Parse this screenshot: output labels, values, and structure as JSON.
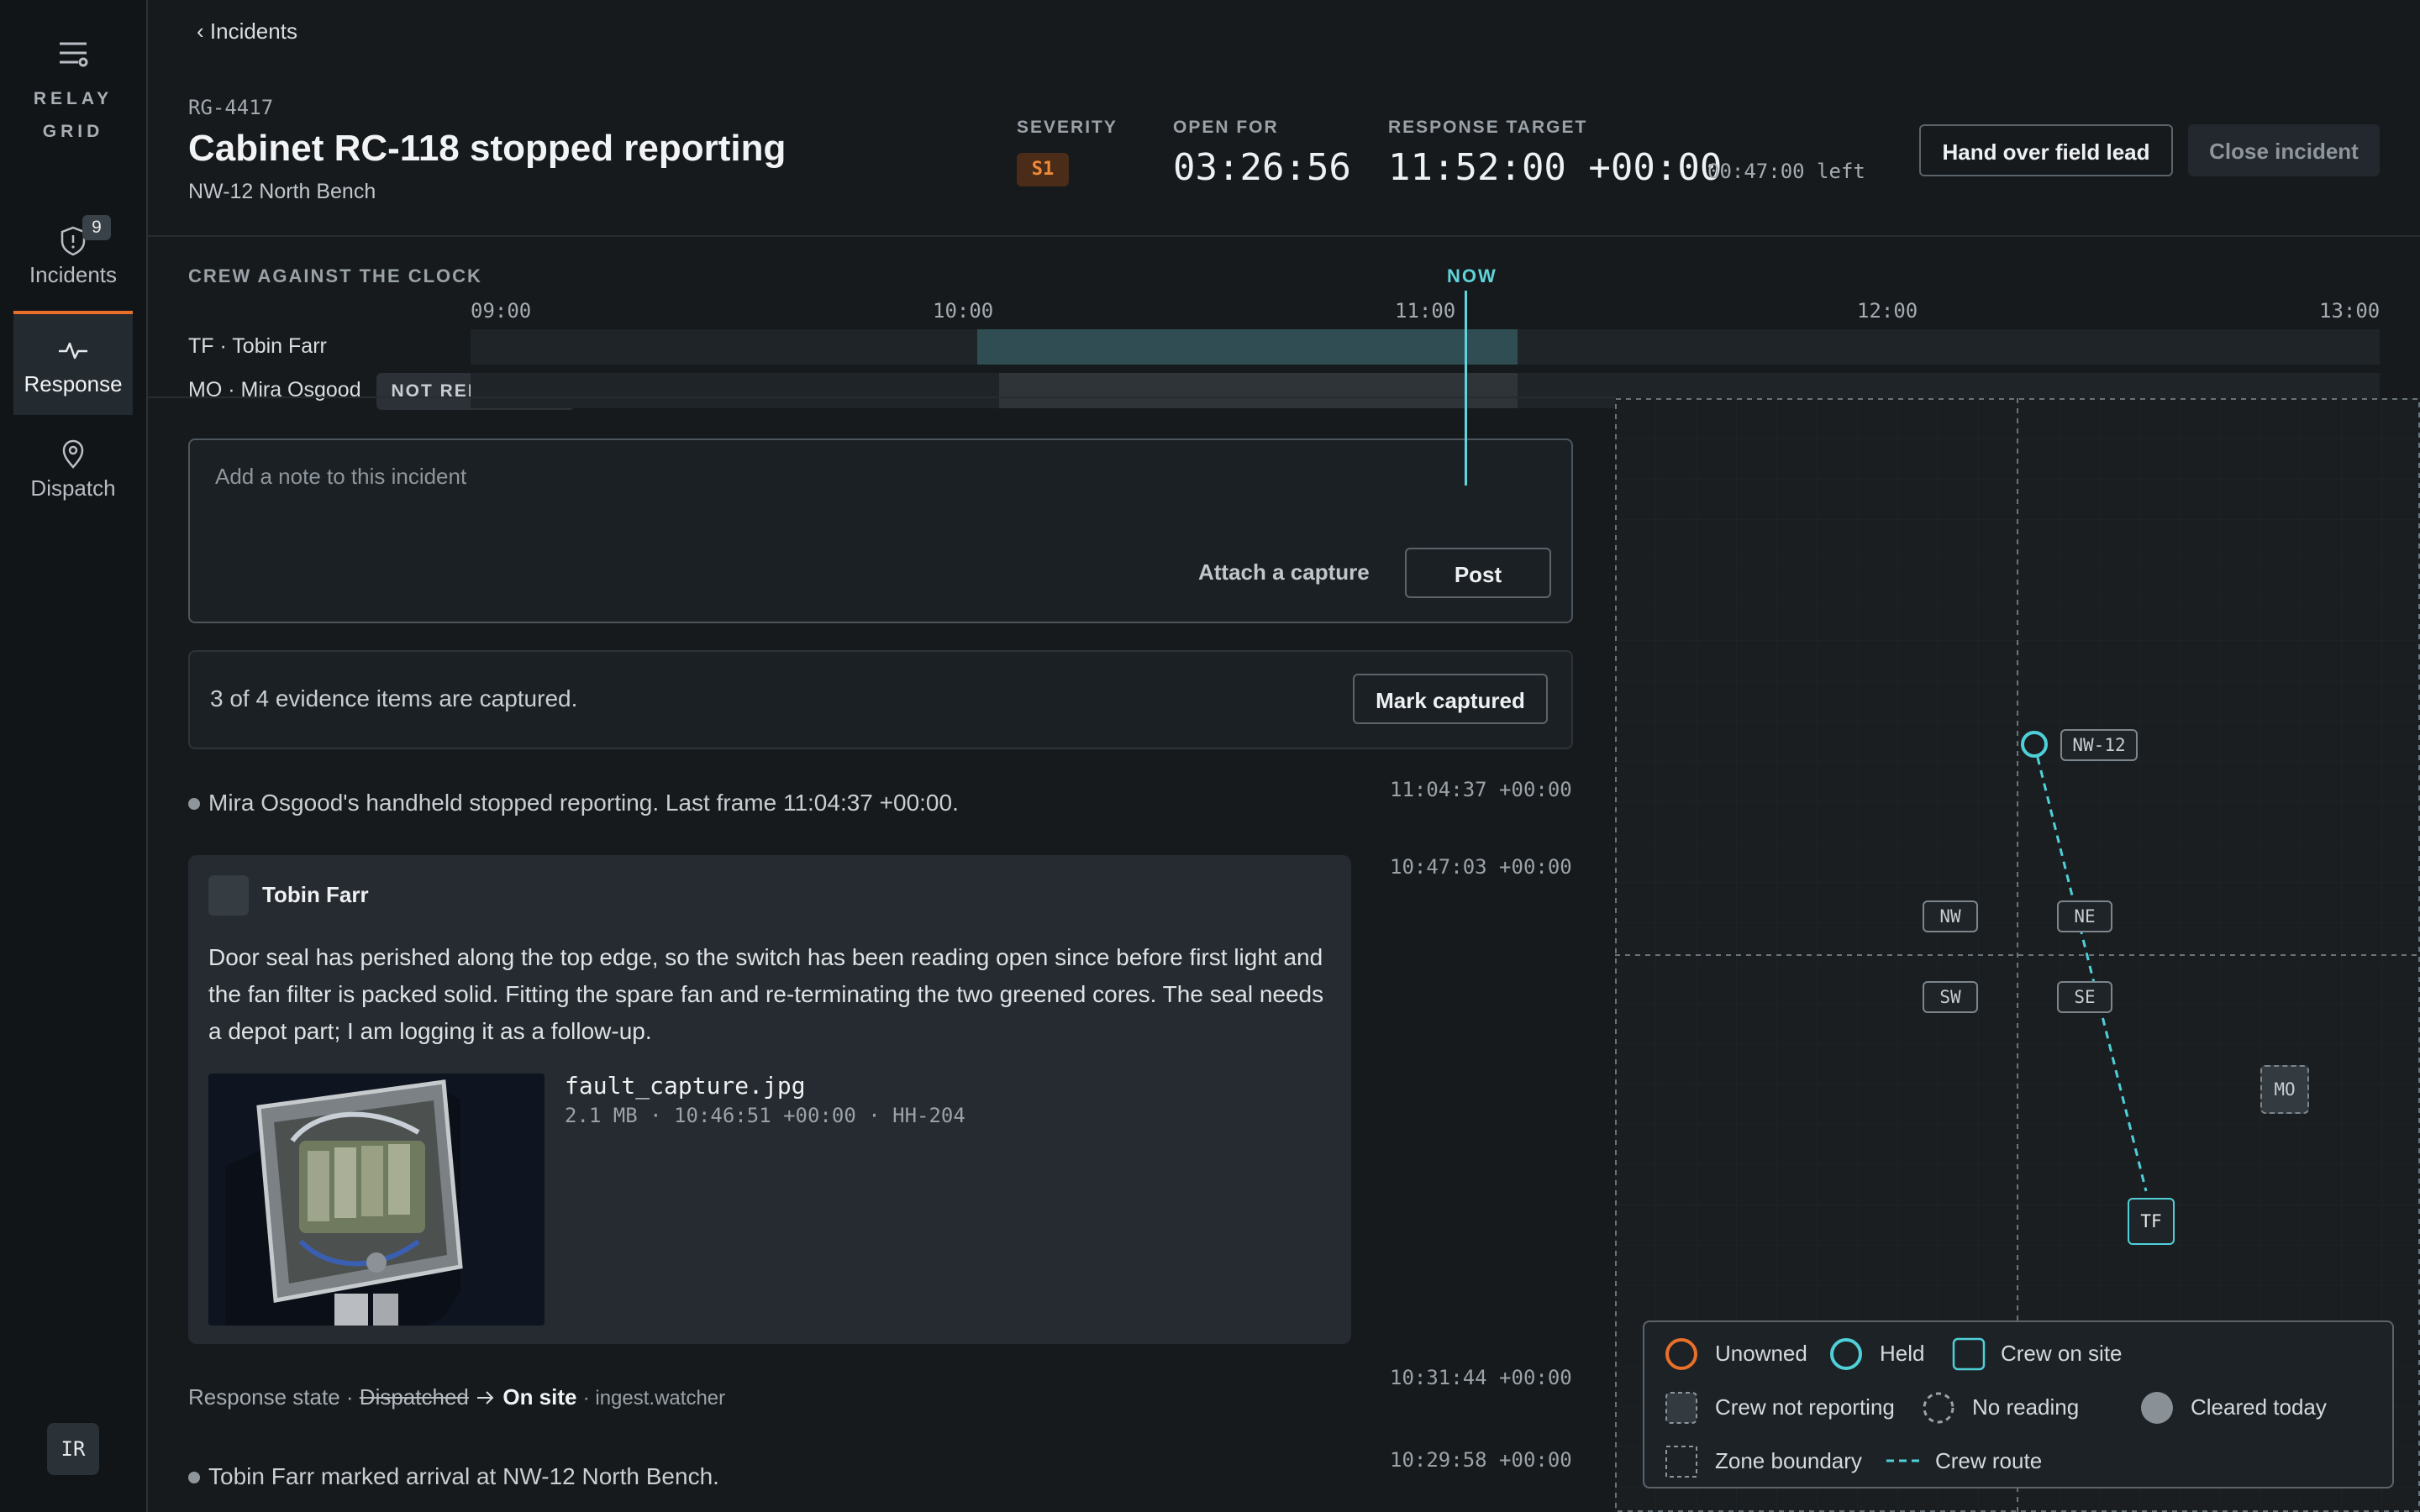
{
  "sidebar": {
    "brand": "RELAY\nGRID",
    "nav": [
      {
        "label": "Incidents",
        "badge": "9"
      },
      {
        "label": "Response"
      },
      {
        "label": "Dispatch"
      }
    ],
    "user_initials": "IR"
  },
  "header": {
    "back_label": "‹ Incidents",
    "incident_id": "RG-4417",
    "title": "Cabinet RC-118 stopped reporting",
    "location": "NW-12 North Bench",
    "severity_label": "SEVERITY",
    "severity_value": "S1",
    "open_for_label": "OPEN FOR",
    "open_for_value": "03:26:56",
    "target_label": "RESPONSE TARGET",
    "target_value": "11:52:00 +00:00",
    "target_left": "00:47:00 left",
    "handover_button": "Hand over field lead",
    "close_button": "Close incident"
  },
  "timeline": {
    "title": "CREW AGAINST THE CLOCK",
    "ticks": [
      "09:00",
      "10:00",
      "11:00",
      "12:00",
      "13:00"
    ],
    "now_label": "NOW",
    "now_fraction": 0.5483,
    "rows": [
      {
        "label": "TF · Tobin Farr",
        "start_fraction": 0.2653,
        "end_fraction": 0.5483
      },
      {
        "label": "MO · Mira Osgood",
        "status": "NOT REPORTING",
        "start_fraction": 0.2767,
        "end_fraction": 0.5483
      }
    ]
  },
  "composer": {
    "placeholder": "Add a note to this incident",
    "attach_label": "Attach a capture",
    "post_button": "Post"
  },
  "evidence": {
    "text": "3 of 4 evidence items are captured.",
    "button": "Mark captured"
  },
  "feed": {
    "event1": {
      "text": "Mira Osgood's handheld stopped reporting. Last frame 11:04:37 +00:00.",
      "time": "11:04:37 +00:00"
    },
    "post": {
      "time": "10:47:03 +00:00",
      "author": "Tobin Farr",
      "body": "Door seal has perished along the top edge, so the switch has been reading open since before first light and the fan filter is packed solid. Fitting the spare fan and re-terminating the two greened cores. The seal needs a depot part; I am logging it as a follow-up.",
      "attachment": {
        "name": "fault_capture.jpg",
        "meta": "2.1 MB · 10:46:51 +00:00 · HH-204"
      }
    },
    "state_change": {
      "time": "10:31:44 +00:00",
      "prefix": "Response state ·",
      "from": "Dispatched",
      "to": "On site",
      "source": "· ingest.watcher"
    },
    "event2": {
      "text": "Tobin Farr marked arrival at NW-12 North Bench.",
      "time": "10:29:58 +00:00"
    }
  },
  "map": {
    "site_label": "NW-12",
    "zones": [
      "NW",
      "NE",
      "SW",
      "SE"
    ],
    "crew_tf": "TF",
    "crew_mo": "MO",
    "colors": {
      "held": "#4fd0d8",
      "unowned": "#e8702a",
      "route": "#4fd0d8"
    },
    "legend": [
      "Unowned",
      "Held",
      "Crew on site",
      "Crew not reporting",
      "No reading",
      "Cleared today",
      "Zone boundary",
      "Crew route"
    ]
  }
}
